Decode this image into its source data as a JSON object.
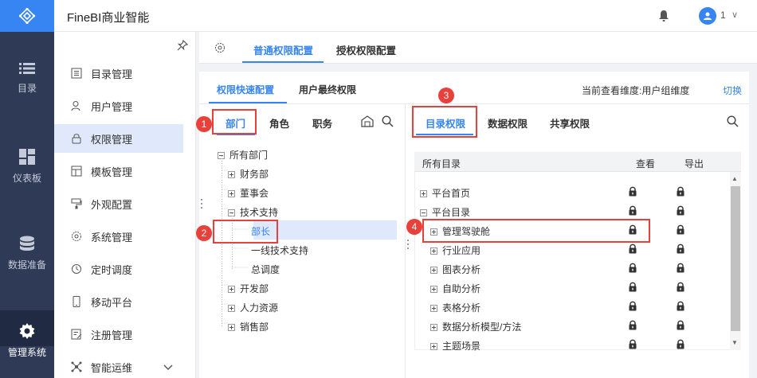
{
  "app": {
    "title": "FineBI商业智能",
    "user_count": "1"
  },
  "left_nav": [
    {
      "label": "目录",
      "icon": "list-icon"
    },
    {
      "label": "仪表板",
      "icon": "dashboard-icon"
    },
    {
      "label": "数据准备",
      "icon": "database-icon"
    },
    {
      "label": "管理系统",
      "icon": "gear-icon"
    }
  ],
  "sub_nav": [
    {
      "label": "目录管理",
      "icon": "catalog-icon"
    },
    {
      "label": "用户管理",
      "icon": "user-icon"
    },
    {
      "label": "权限管理",
      "icon": "lock-icon"
    },
    {
      "label": "模板管理",
      "icon": "template-icon"
    },
    {
      "label": "外观配置",
      "icon": "paint-icon"
    },
    {
      "label": "系统管理",
      "icon": "settings-icon"
    },
    {
      "label": "定时调度",
      "icon": "clock-icon"
    },
    {
      "label": "移动平台",
      "icon": "mobile-icon"
    },
    {
      "label": "注册管理",
      "icon": "register-icon"
    },
    {
      "label": "智能运维",
      "icon": "ops-icon"
    }
  ],
  "top_tabs": [
    "普通权限配置",
    "授权权限配置"
  ],
  "sub_tabs": [
    "权限快速配置",
    "用户最终权限"
  ],
  "dimension": {
    "label": "当前查看维度:用户组维度",
    "switch": "切换"
  },
  "org_tabs": [
    "部门",
    "角色",
    "职务"
  ],
  "org_tree": [
    {
      "label": "所有部门"
    },
    {
      "label": "财务部"
    },
    {
      "label": "董事会"
    },
    {
      "label": "技术支持"
    },
    {
      "label": "部长"
    },
    {
      "label": "一线技术支持"
    },
    {
      "label": "总调度"
    },
    {
      "label": "开发部"
    },
    {
      "label": "人力资源"
    },
    {
      "label": "销售部"
    }
  ],
  "perm_tabs": [
    "目录权限",
    "数据权限",
    "共享权限"
  ],
  "table": {
    "headers": [
      "所有目录",
      "查看",
      "导出"
    ],
    "rows": [
      "平台首页",
      "平台目录",
      "管理驾驶舱",
      "行业应用",
      "图表分析",
      "自助分析",
      "表格分析",
      "数据分析模型/方法",
      "主题场景"
    ]
  },
  "badges": [
    "1",
    "2",
    "3",
    "4"
  ],
  "colors": {
    "accent": "#3685f2",
    "highlight": "#e8413b",
    "nav_bg": "#2f3a56"
  }
}
